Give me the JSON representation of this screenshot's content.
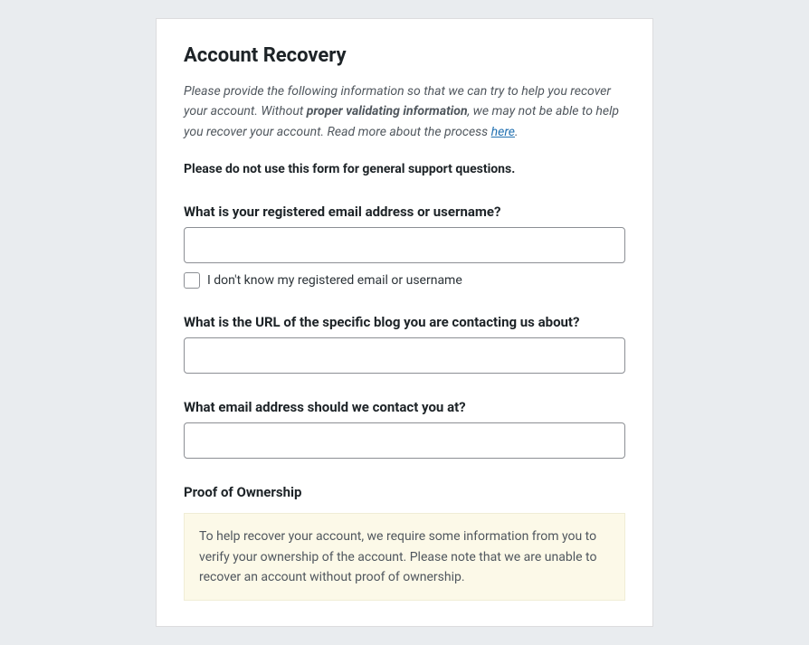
{
  "title": "Account Recovery",
  "intro": {
    "part1": "Please provide the following information so that we can try to help you recover your account. Without ",
    "bold": "proper validating information",
    "part2": ", we may not be able to help you recover your account. Read more about the process ",
    "link_text": "here",
    "part3": "."
  },
  "warning": "Please do not use this form for general support questions.",
  "fields": {
    "email_or_username": {
      "label": "What is your registered email address or username?",
      "checkbox_label": "I don't know my registered email or username"
    },
    "blog_url": {
      "label": "What is the URL of the specific blog you are contacting us about?"
    },
    "contact_email": {
      "label": "What email address should we contact you at?"
    }
  },
  "proof": {
    "title": "Proof of Ownership",
    "notice": "To help recover your account, we require some information from you to verify your ownership of the account. Please note that we are unable to recover an account without proof of ownership."
  }
}
